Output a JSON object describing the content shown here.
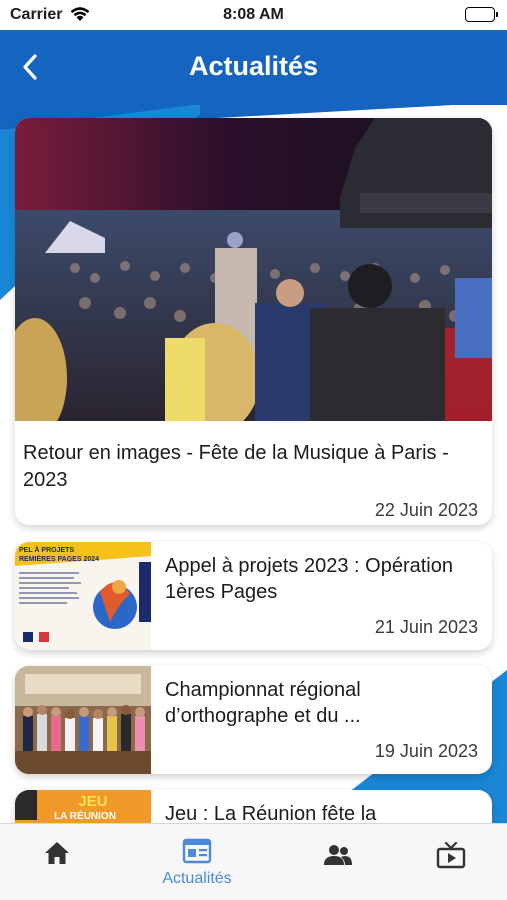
{
  "status_bar": {
    "carrier": "Carrier",
    "time": "8:08 AM"
  },
  "header": {
    "title": "Actualités",
    "back_icon": "chevron-left-icon"
  },
  "colors": {
    "header_blue": "#1565c0",
    "accent_stripe": "#1a86d6",
    "tab_active": "#4a8ad8",
    "tab_inactive": "#333333"
  },
  "news": {
    "featured": {
      "title": "Retour en images - Fête de la Musique à Paris - 2023",
      "date": "22 Juin 2023",
      "image": "concert-crowd-photo"
    },
    "items": [
      {
        "title": "Appel à projets 2023 : Opération 1ères Pages",
        "date": "21 Juin 2023",
        "image": "poster-thumbnail",
        "thumb_text": "PEL À PROJETS\nREMIÈRES PAGES 2024"
      },
      {
        "title": "Championnat régional d’orthographe et du ...",
        "date": "19 Juin 2023",
        "image": "group-photo-thumbnail"
      },
      {
        "title": "Jeu : La Réunion fête la",
        "date": "",
        "image": "jeu-poster-thumbnail",
        "thumb_text": "JEU\nLA RÉUNION"
      }
    ]
  },
  "tabbar": {
    "tabs": [
      {
        "icon": "home-icon",
        "label": "",
        "active": false
      },
      {
        "icon": "newspaper-icon",
        "label": "Actualités",
        "active": true
      },
      {
        "icon": "people-icon",
        "label": "",
        "active": false
      },
      {
        "icon": "tv-play-icon",
        "label": "",
        "active": false
      }
    ]
  }
}
